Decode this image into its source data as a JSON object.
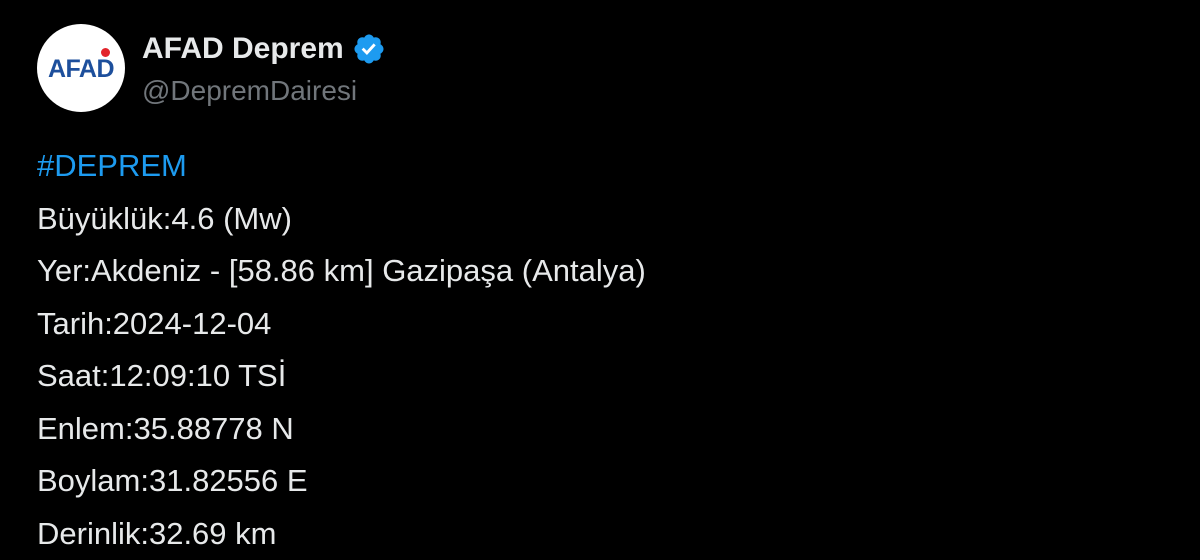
{
  "account": {
    "display_name": "AFAD Deprem",
    "handle": "@DepremDairesi",
    "avatar_text": "AFAD",
    "verified_icon": "verified-badge-icon"
  },
  "tweet": {
    "hashtag": "#DEPREM",
    "lines": [
      "Büyüklük:4.6 (Mw)",
      "Yer:Akdeniz - [58.86 km] Gazipaşa (Antalya)",
      "Tarih:2024-12-04",
      "Saat:12:09:10 TSİ",
      "Enlem:35.88778 N",
      "Boylam:31.82556 E",
      "Derinlik:32.69 km"
    ]
  },
  "colors": {
    "background": "#000000",
    "text": "#e7e9ea",
    "muted": "#71767b",
    "accent": "#1d9bf0",
    "avatar_brand": "#1d4f9c"
  }
}
